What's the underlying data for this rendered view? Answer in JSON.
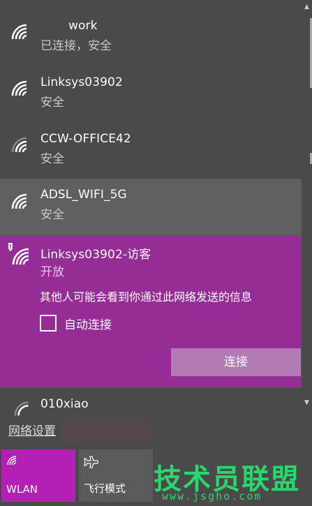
{
  "networks": [
    {
      "name": "work",
      "status": "已连接，安全"
    },
    {
      "name": "Linksys03902",
      "status": "安全"
    },
    {
      "name": "CCW-OFFICE42",
      "status": "安全"
    },
    {
      "name": "ADSL_WIFI_5G",
      "status": "安全"
    }
  ],
  "expanded": {
    "name": "Linksys03902-访客",
    "status": "开放",
    "warning": "其他人可能会看到你通过此网络发送的信息",
    "auto_connect_label": "自动连接",
    "auto_connect_checked": false,
    "connect_label": "连接"
  },
  "partial_network": {
    "name": "010xiao"
  },
  "bottom": {
    "settings_link": "网络设置",
    "tiles": [
      {
        "label": "WLAN",
        "icon": "wifi-icon",
        "active": true
      },
      {
        "label": "飞行模式",
        "icon": "airplane-icon",
        "active": false
      }
    ]
  },
  "watermark": {
    "title": "技术员联盟",
    "url": "www.jsgho.com"
  },
  "colors": {
    "accent": "#962d97",
    "tile_active": "#b41fb6",
    "connect_button": "#b27bb4",
    "watermark": "#27d86a"
  }
}
